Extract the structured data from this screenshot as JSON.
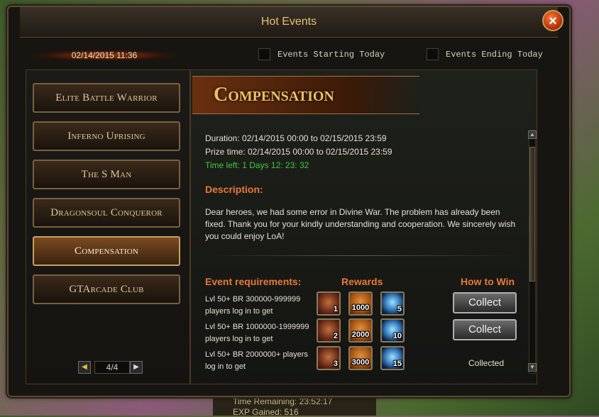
{
  "window": {
    "title": "Hot Events"
  },
  "header": {
    "date": "02/14/2015 11:36",
    "filters": [
      {
        "label": "Events Starting Today",
        "checked": false
      },
      {
        "label": "Events Ending Today",
        "checked": false
      }
    ]
  },
  "sidebar": {
    "items": [
      {
        "label": "Elite Battle Warrior"
      },
      {
        "label": "Inferno Uprising"
      },
      {
        "label": "The S Man"
      },
      {
        "label": "Dragonsoul Conqueror"
      },
      {
        "label": "Compensation",
        "active": true
      },
      {
        "label": "GTArcade Club"
      }
    ],
    "pager": {
      "text": "4/4"
    }
  },
  "event": {
    "banner": "Compensation",
    "duration": "Duration: 02/14/2015 00:00 to 02/15/2015 23:59",
    "prize_time": "Prize time: 02/14/2015 00:00 to 02/15/2015 23:59",
    "time_left": "Time left: 1 Days  12: 23: 32",
    "description_title": "Description:",
    "description": "Dear heroes, we had some error in Divine War. The problem has already been fixed. Thank you for your kindly understanding and cooperation. We sincerely wish you could enjoy LoA!",
    "requirements_title": "Event requirements:",
    "rewards_title": "Rewards",
    "how_to_win_title": "How to Win",
    "rows": [
      {
        "requirement": "Lvl 50+ BR 300000-999999 players log in to get",
        "chest": "1",
        "gold": "1000",
        "gem": "5",
        "action": "Collect"
      },
      {
        "requirement": "Lvl 50+ BR 1000000-1999999 players log in to get",
        "chest": "2",
        "gold": "2000",
        "gem": "10",
        "action": "Collect"
      },
      {
        "requirement": "Lvl 50+ BR 2000000+ players log in to get",
        "chest": "3",
        "gold": "3000",
        "gem": "15",
        "status": "Collected"
      }
    ]
  },
  "background_text": {
    "time_remaining": "Time Remaining: 23:52:17",
    "exp_gained": "EXP Gained: 516"
  },
  "colors": {
    "accent_orange": "#e67a3c",
    "gold_text": "#e8c070",
    "time_left_green": "#3ccc3c"
  },
  "icons": [
    "close-icon",
    "chest-icon",
    "gold-icon",
    "gem-icon",
    "prev-arrow-icon",
    "next-arrow-icon"
  ]
}
